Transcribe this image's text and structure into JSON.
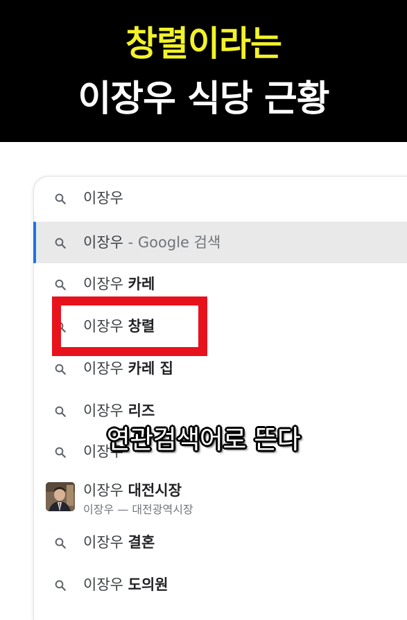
{
  "banner": {
    "line1": "창렬이라는",
    "line2": "이장우 식당 근황"
  },
  "search": {
    "query": "이장우",
    "suggestions": [
      {
        "prefix": "이장우",
        "bold": "",
        "suffix": "- Google 검색",
        "highlighted": true
      },
      {
        "prefix": "이장우 ",
        "bold": "카레"
      },
      {
        "prefix": "이장우 ",
        "bold": "창렬"
      },
      {
        "prefix": "이장우 ",
        "bold": "카레 집"
      },
      {
        "prefix": "이장우 ",
        "bold": "리즈"
      },
      {
        "prefix": "이장우",
        "bold": ""
      }
    ],
    "entity": {
      "prefix": "이장우 ",
      "bold": "대전시장",
      "subtitle": "이장우 — 대전광역시장"
    },
    "more_suggestions": [
      {
        "prefix": "이장우 ",
        "bold": "결혼"
      },
      {
        "prefix": "이장우 ",
        "bold": "도의원"
      }
    ]
  },
  "caption": "연관검색어로 뜬다",
  "colors": {
    "banner_bg": "#000000",
    "banner_title_yellow": "#f2f22a",
    "highlight_box": "#e8121c",
    "selected_accent": "#1a73e8"
  }
}
